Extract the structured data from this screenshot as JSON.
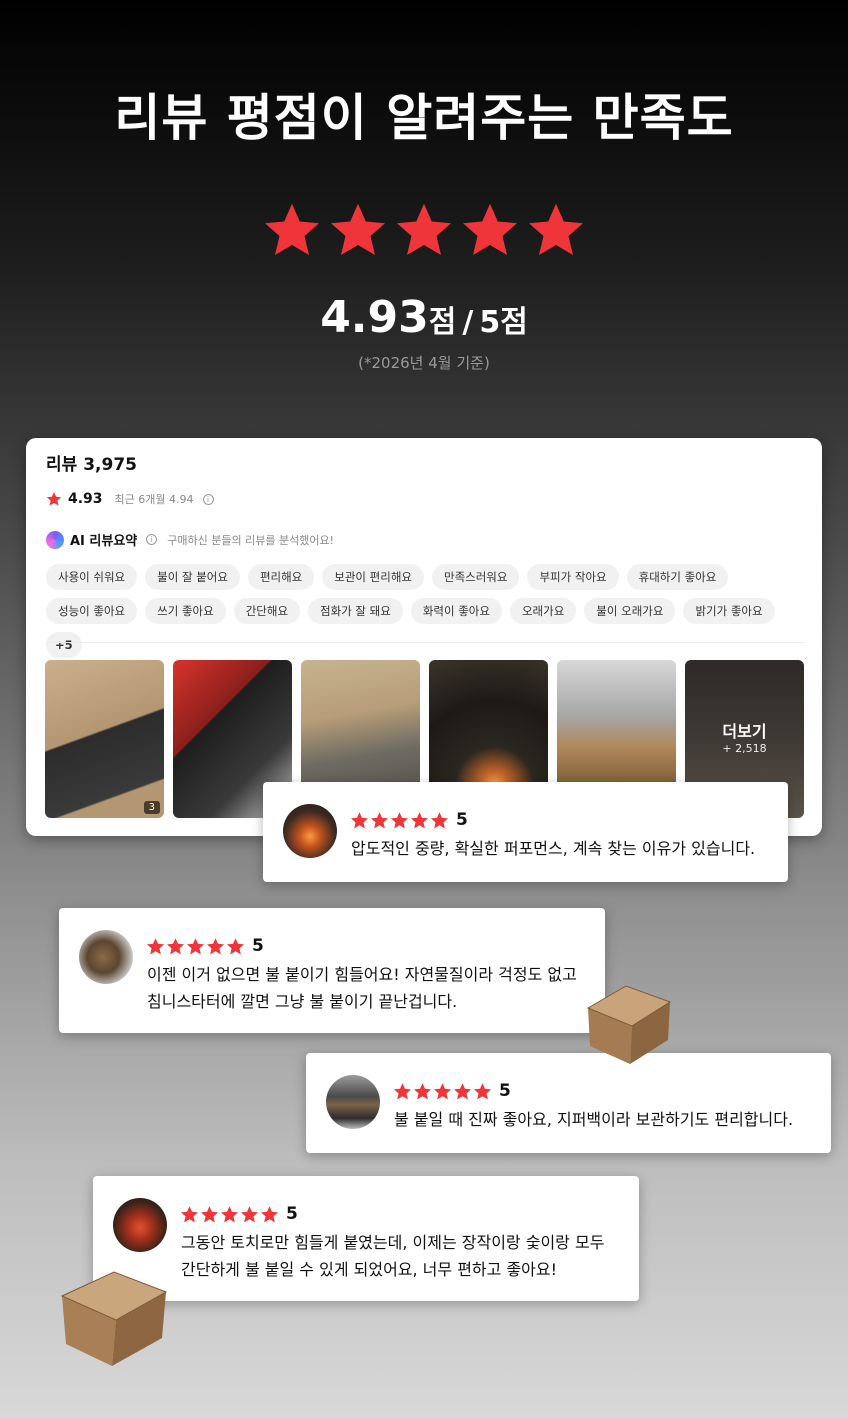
{
  "header": {
    "headline": "리뷰 평점이 알려주는 만족도",
    "stars_filled": 5,
    "score": "4.93",
    "score_unit": "점",
    "slash": "/",
    "max_score": "5점",
    "basis_note": "(*2026년 4월 기준)"
  },
  "colors": {
    "star": "#f0353a",
    "background_top": "#000000",
    "background_bottom": "#d8d8d8"
  },
  "review_panel": {
    "title": "리뷰 3,975",
    "rating_icon": "star-icon",
    "rating": "4.93",
    "recent_rating": "최근 6개월 4.94",
    "ai_summary_title": "AI 리뷰요약",
    "ai_summary_desc": "구매하신 분들의 리뷰를 분석했어요!",
    "tags": [
      "사용이 쉬워요",
      "불이 잘 붙어요",
      "편리해요",
      "보관이 편리해요",
      "만족스러워요",
      "부피가 작아요",
      "휴대하기 좋아요",
      "성능이 좋아요",
      "쓰기 좋아요",
      "간단해요",
      "점화가 잘 돼요",
      "화력이 좋아요",
      "오래가요",
      "불이 오래가요",
      "밝기가 좋아요"
    ],
    "tags_more": "+5",
    "photos": [
      {
        "name": "photo-box-package",
        "badge": "3"
      },
      {
        "name": "photo-product-bags",
        "badge": ""
      },
      {
        "name": "photo-box-open",
        "badge": ""
      },
      {
        "name": "photo-night-campfire",
        "badge": ""
      },
      {
        "name": "photo-grill-cubes",
        "badge": ""
      }
    ],
    "more_photos_label": "더보기",
    "more_photos_count": "+ 2,518"
  },
  "reviews": [
    {
      "stars": 5,
      "score": "5",
      "text": "압도적인 중량, 확실한 퍼포먼스, 계속 찾는 이유가 있습니다."
    },
    {
      "stars": 5,
      "score": "5",
      "text": "이젠 이거 없으면 불 붙이기 힘들어요! 자연물질이라 걱정도 없고\n침니스타터에 깔면 그냥 불 붙이기 끝난겁니다."
    },
    {
      "stars": 5,
      "score": "5",
      "text": "불 붙일 때 진짜 좋아요, 지퍼백이라 보관하기도 편리합니다."
    },
    {
      "stars": 5,
      "score": "5",
      "text": "그동안 토치로만 힘들게 붙였는데, 이제는 장작이랑 숯이랑 모두\n간단하게 불 붙일 수 있게 되었어요, 너무 편하고 좋아요!"
    }
  ]
}
